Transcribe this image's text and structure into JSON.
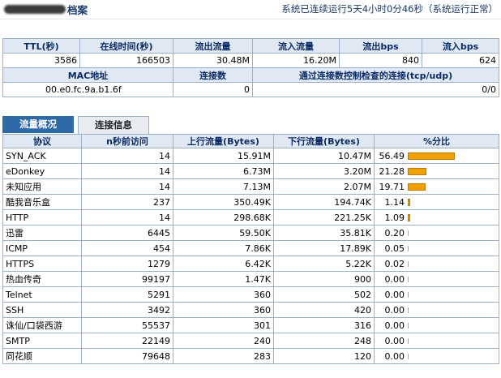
{
  "header": {
    "title_suffix": "档案",
    "status": "系统已连续运行5天4小时0分46秒（系统运行正常）"
  },
  "summary": {
    "headers": [
      "TTL(秒)",
      "在线时间(秒)",
      "流出流量",
      "流入流量",
      "流出bps",
      "流入bps"
    ],
    "values": [
      "3586",
      "166503",
      "30.48M",
      "16.20M",
      "840",
      "624"
    ],
    "headers2": [
      "MAC地址",
      "连接数",
      "通过连接数控制检查的连接(tcp/udp)"
    ],
    "values2": [
      "00.e0.fc.9a.b1.6f",
      "0",
      "0/0"
    ]
  },
  "tabs": [
    "流量概况",
    "连接信息"
  ],
  "traffic": {
    "headers": [
      "协议",
      "n秒前访问",
      "上行流量(Bytes)",
      "下行流量(Bytes)",
      "%分比"
    ],
    "rows": [
      {
        "protocol": "SYN_ACK",
        "ago": "14",
        "up": "15.91M",
        "down": "10.47M",
        "pct": 56.49,
        "pct_text": "56.49"
      },
      {
        "protocol": "eDonkey",
        "ago": "14",
        "up": "6.73M",
        "down": "3.20M",
        "pct": 21.28,
        "pct_text": "21.28"
      },
      {
        "protocol": "未知应用",
        "ago": "14",
        "up": "7.13M",
        "down": "2.07M",
        "pct": 19.71,
        "pct_text": "19.71"
      },
      {
        "protocol": "酷我音乐盒",
        "ago": "237",
        "up": "350.49K",
        "down": "194.74K",
        "pct": 1.14,
        "pct_text": "1.14"
      },
      {
        "protocol": "HTTP",
        "ago": "14",
        "up": "298.68K",
        "down": "221.25K",
        "pct": 1.09,
        "pct_text": "1.09"
      },
      {
        "protocol": "迅雷",
        "ago": "6445",
        "up": "59.50K",
        "down": "35.81K",
        "pct": 0.2,
        "pct_text": "0.20"
      },
      {
        "protocol": "ICMP",
        "ago": "454",
        "up": "7.86K",
        "down": "17.89K",
        "pct": 0.05,
        "pct_text": "0.05"
      },
      {
        "protocol": "HTTPS",
        "ago": "1279",
        "up": "6.42K",
        "down": "5.22K",
        "pct": 0.02,
        "pct_text": "0.02"
      },
      {
        "protocol": "热血传奇",
        "ago": "99197",
        "up": "1.47K",
        "down": "900",
        "pct": 0.0,
        "pct_text": "0.00"
      },
      {
        "protocol": "Telnet",
        "ago": "5291",
        "up": "360",
        "down": "502",
        "pct": 0.0,
        "pct_text": "0.00"
      },
      {
        "protocol": "SSH",
        "ago": "3492",
        "up": "360",
        "down": "420",
        "pct": 0.0,
        "pct_text": "0.00"
      },
      {
        "protocol": "诛仙/口袋西游",
        "ago": "55537",
        "up": "301",
        "down": "316",
        "pct": 0.0,
        "pct_text": "0.00"
      },
      {
        "protocol": "SMTP",
        "ago": "22149",
        "up": "240",
        "down": "248",
        "pct": 0.0,
        "pct_text": "0.00"
      },
      {
        "protocol": "同花顺",
        "ago": "79648",
        "up": "283",
        "down": "120",
        "pct": 0.0,
        "pct_text": "0.00"
      }
    ]
  }
}
